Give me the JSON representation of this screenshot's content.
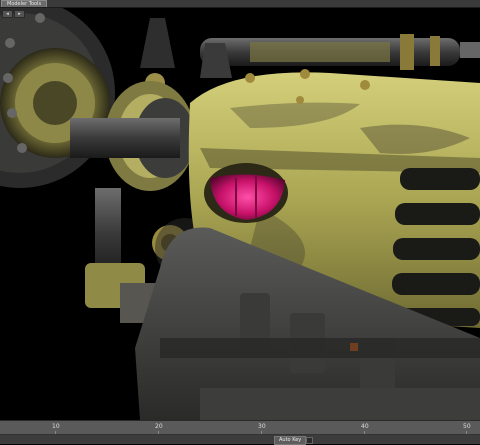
{
  "app": {
    "tab_label": "Modeler Tools",
    "mini_buttons": [
      "◂",
      "▸"
    ]
  },
  "viewport": {
    "scene": "3D render of a weathered yellow machine with glowing magenta eye and pipes",
    "colors": {
      "hull_yellow": "#b9b35a",
      "rust_dark": "#3b3a2a",
      "metal_grey": "#4a4a4a",
      "eye_magenta": "#e0187a",
      "brass": "#a08a3c"
    }
  },
  "timeline": {
    "ticks": [
      "10",
      "20",
      "30",
      "40",
      "50"
    ],
    "autokey_label": "Auto Key"
  }
}
